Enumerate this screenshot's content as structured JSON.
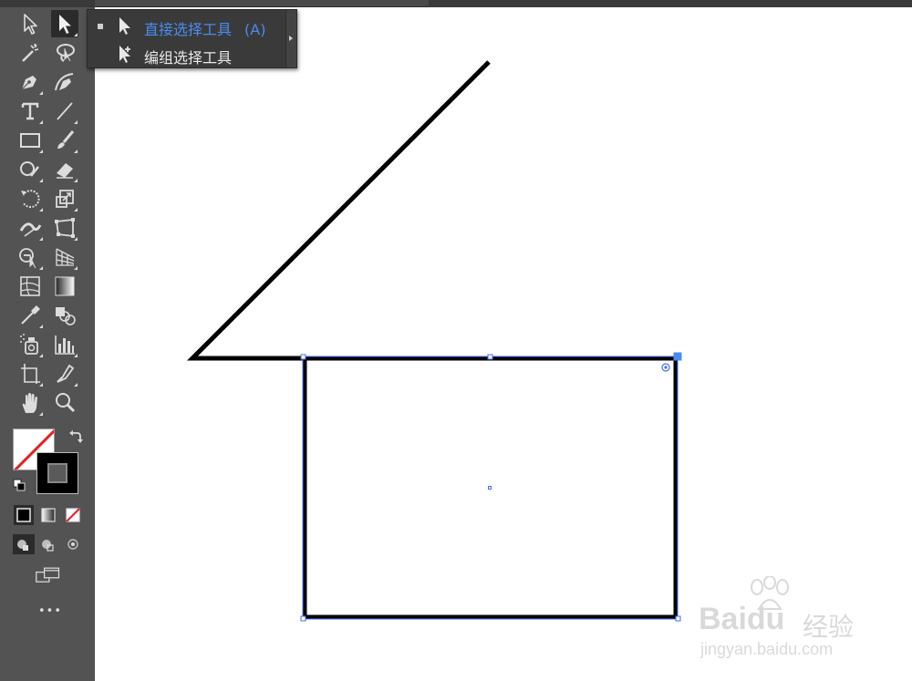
{
  "app": {
    "accent": "#4a8cf0",
    "panel_bg": "#535353",
    "canvas_bg": "#ffffff"
  },
  "flyout": {
    "items": [
      {
        "label": "直接选择工具",
        "shortcut": "(A)",
        "icon": "direct-selection-icon",
        "active": true,
        "color": "#4a8cf0"
      },
      {
        "label": "编组选择工具",
        "shortcut": "",
        "icon": "group-selection-icon",
        "active": false,
        "color": "#e8e8e8"
      }
    ]
  },
  "toolbar": {
    "tools": [
      "direct-selection-icon",
      "selection-icon",
      "magic-wand-icon",
      "lasso-icon",
      "pen-icon",
      "curvature-icon",
      "type-icon",
      "line-segment-icon",
      "rectangle-icon",
      "paintbrush-icon",
      "shaper-icon",
      "eraser-icon",
      "rotate-icon",
      "scale-icon",
      "width-icon",
      "free-transform-icon",
      "shape-builder-icon",
      "perspective-grid-icon",
      "mesh-icon",
      "gradient-icon",
      "eyedropper-icon",
      "blend-icon",
      "symbol-sprayer-icon",
      "column-graph-icon",
      "artboard-icon",
      "slice-icon",
      "hand-icon",
      "zoom-icon"
    ],
    "more_label": "•••"
  },
  "watermark": {
    "brand": "Baidu",
    "sub": "经验",
    "url": "jingyan.baidu.com"
  }
}
